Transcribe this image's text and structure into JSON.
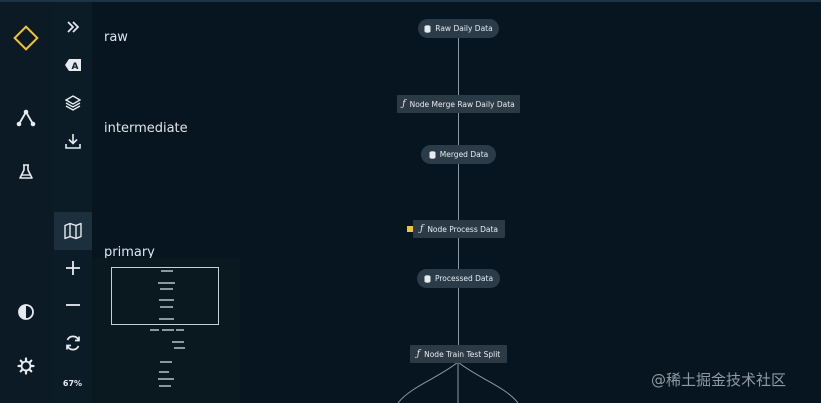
{
  "toolbar": {
    "zoom_level": "67%"
  },
  "layers": {
    "raw": "raw",
    "intermediate": "intermediate",
    "primary": "primary"
  },
  "pipeline": {
    "nodes": [
      {
        "id": "raw-daily-data",
        "type": "data",
        "label": "Raw Daily Data"
      },
      {
        "id": "node-merge-raw-daily-data",
        "type": "task",
        "label": "Node Merge Raw Daily Data"
      },
      {
        "id": "merged-data",
        "type": "data",
        "label": "Merged Data"
      },
      {
        "id": "node-process-data",
        "type": "task",
        "label": "Node Process Data"
      },
      {
        "id": "processed-data",
        "type": "data",
        "label": "Processed Data"
      },
      {
        "id": "node-train-test-split",
        "type": "task",
        "label": "Node Train Test Split"
      }
    ]
  },
  "colors": {
    "background": "#061520",
    "node": "#2b3b48",
    "accent_logo": "#f3c42c",
    "selected_marker": "#f3c42c"
  },
  "watermark": "@稀土掘金技术社区"
}
